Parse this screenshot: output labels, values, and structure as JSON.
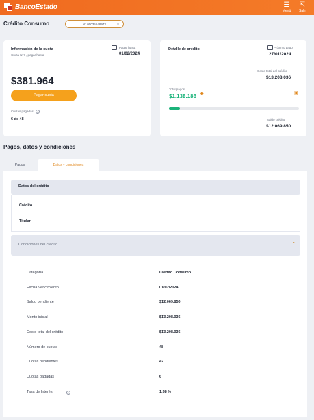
{
  "header": {
    "brand": "BancoEstado",
    "menu_label": "Menú",
    "exit_label": "Salir",
    "colors": {
      "bar": "#f06a1f",
      "accent": "#f5a11c",
      "green": "#1bb37a"
    }
  },
  "title_row": {
    "title": "Crédito Consumo",
    "account_select": "N° 00035548973"
  },
  "cuota_card": {
    "title": "Información de la cuota",
    "subtitle": "Cuota N°7 , pagar hasta",
    "due_label": "Pagar hasta",
    "due_date": "01/02/2024",
    "amount": "$381.964",
    "pay_button": "Pagar cuota",
    "paid_label": "Cuotas pagadas",
    "paid_value": "6 de 48"
  },
  "detalle_card": {
    "title": "Detalle de crédito",
    "next_payment_label": "Próximo pago",
    "next_payment_date": "27/01/2024",
    "total_cost_label": "Costo total del crédito",
    "total_cost_value": "$13.208.036",
    "total_payments_label": "Total pagos",
    "total_payments_value": "$1.138.186",
    "progress_fraction": 0.086,
    "balance_label": "Saldo crédito",
    "balance_value": "$12.069.850"
  },
  "section": {
    "title": "Pagos, datos y condiciones",
    "tabs": [
      "Pagos",
      "Datos y condiciones"
    ],
    "active_tab": "Datos y condiciones"
  },
  "datos_credito": {
    "title": "Datos del crédito",
    "items": [
      "Crédito",
      "Titular"
    ]
  },
  "condiciones": {
    "title": "Condiciones del crédito",
    "rows": [
      {
        "key": "Categoría",
        "value": "Crédito Consumo"
      },
      {
        "key": "Fecha Vencimiento",
        "value": "01/02/2024"
      },
      {
        "key": "Saldo pendiente",
        "value": "$12.069.850"
      },
      {
        "key": "Monto inicial",
        "value": "$13.208.036"
      },
      {
        "key": "Costo total del crédito",
        "value": "$13.208.036"
      },
      {
        "key": "Número de cuotas",
        "value": "48"
      },
      {
        "key": "Cuotas pendientes",
        "value": "42"
      },
      {
        "key": "Cuotas pagadas",
        "value": "6"
      },
      {
        "key": "Tasa de Interés",
        "value": "1.38 %"
      }
    ]
  }
}
